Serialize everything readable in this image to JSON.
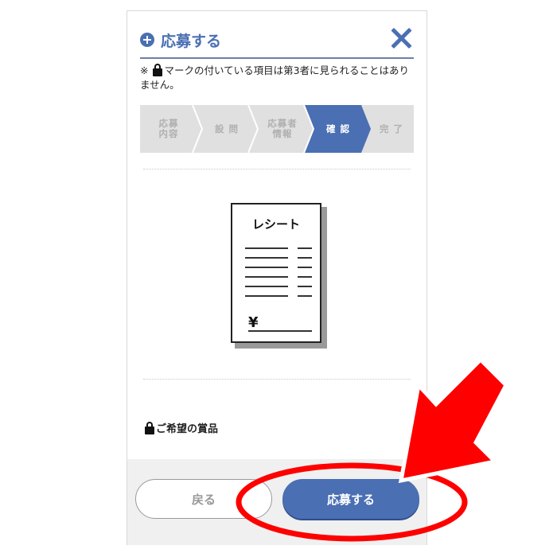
{
  "modal": {
    "title": "応募する",
    "notice_prefix": "※",
    "notice_text": "マークの付いている項目は第3者に見られることはありません。"
  },
  "steps": [
    {
      "label": "応募\n内容",
      "active": false
    },
    {
      "label": "設 問",
      "active": false
    },
    {
      "label": "応募者\n情報",
      "active": false
    },
    {
      "label": "確 認",
      "active": true
    },
    {
      "label": "完 了",
      "active": false
    }
  ],
  "receipt": {
    "title": "レシート",
    "currency_symbol": "¥"
  },
  "prize": {
    "label": "ご希望の賞品"
  },
  "footer": {
    "back_label": "戻る",
    "apply_label": "応募する"
  },
  "colors": {
    "brand": "#4a6fb3",
    "step_inactive_bg": "#e0e0e0",
    "step_active_bg": "#4a6fb3",
    "annotation_red": "#ff0000"
  },
  "icons": [
    "plus-circle-icon",
    "close-icon",
    "lock-icon",
    "red-arrow-annotation",
    "red-circle-annotation"
  ]
}
